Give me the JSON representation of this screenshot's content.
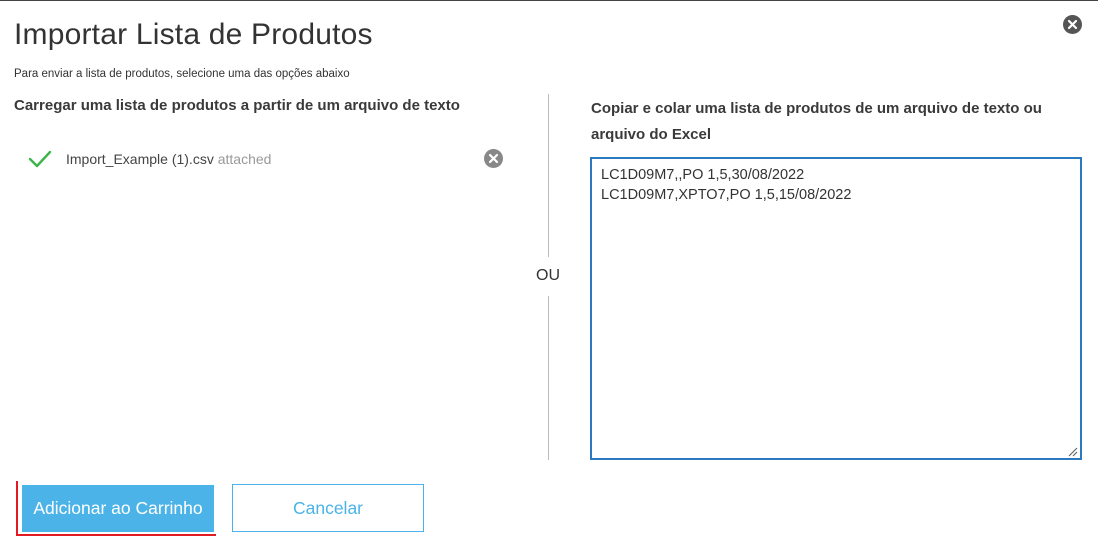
{
  "modal": {
    "title": "Importar Lista de Produtos",
    "subtitle": "Para enviar a lista de produtos, selecione uma das opções abaixo",
    "close_icon": "close-circle-icon"
  },
  "upload": {
    "heading": "Carregar uma lista de produtos a partir de um arquivo de texto",
    "file_name": "Import_Example (1).csv",
    "file_status": "attached",
    "status_icon": "check-icon",
    "status_color": "#3cb54a",
    "remove_icon": "remove-circle-icon"
  },
  "separator": {
    "label": "OU"
  },
  "paste": {
    "heading": "Copiar e colar uma lista de produtos de um arquivo de texto ou arquivo do Excel",
    "lines": [
      "LC1D09M7,,PO 1,5,30/08/2022",
      "LC1D09M7,XPTO7,PO 1,5,15/08/2022"
    ],
    "border_color": "#2b7ac0"
  },
  "actions": {
    "add_to_cart_label": "Adicionar ao Carrinho",
    "cancel_label": "Cancelar",
    "primary_color": "#4bb3e8",
    "highlight_color": "#e11b22"
  }
}
